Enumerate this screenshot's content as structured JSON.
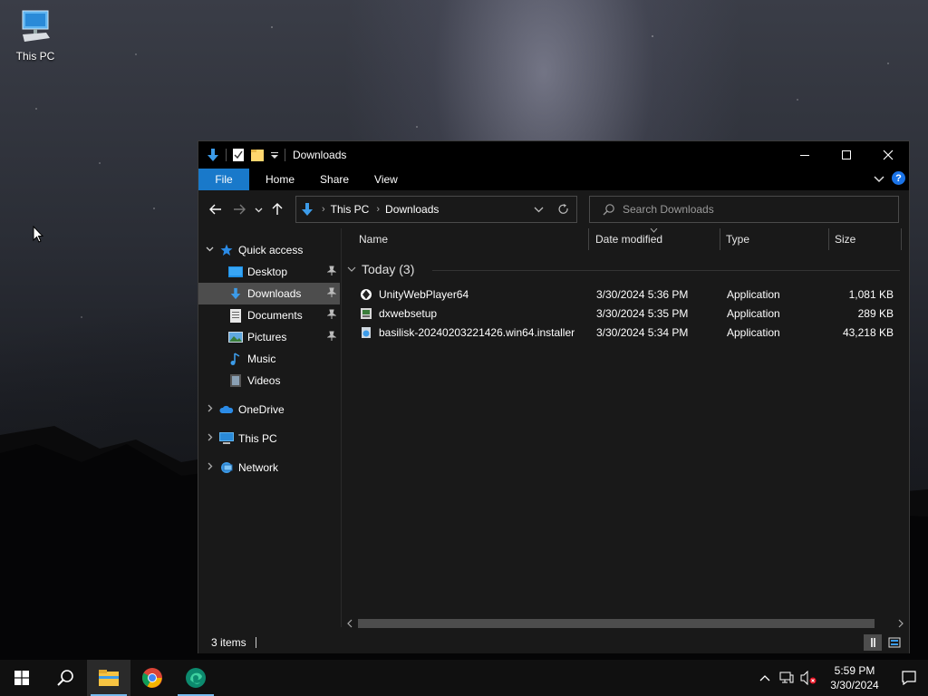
{
  "desktop": {
    "icons": [
      {
        "label": "This PC",
        "icon": "this-pc-icon"
      }
    ]
  },
  "window": {
    "title": "Downloads",
    "controls": {
      "minimize": "minimize-icon",
      "maximize": "maximize-icon",
      "close": "close-icon"
    }
  },
  "ribbon": {
    "tabs": [
      "File",
      "Home",
      "Share",
      "View"
    ],
    "help_label": "?"
  },
  "address": {
    "segments": [
      "This PC",
      "Downloads"
    ]
  },
  "search": {
    "placeholder": "Search Downloads"
  },
  "nav_pane": {
    "quick_access": "Quick access",
    "pinned": [
      {
        "label": "Desktop",
        "icon": "desktop-folder-icon",
        "pinned": true
      },
      {
        "label": "Downloads",
        "icon": "downloads-folder-icon",
        "pinned": true,
        "selected": true
      },
      {
        "label": "Documents",
        "icon": "documents-folder-icon",
        "pinned": true
      },
      {
        "label": "Pictures",
        "icon": "pictures-folder-icon",
        "pinned": true
      },
      {
        "label": "Music",
        "icon": "music-folder-icon",
        "pinned": false
      },
      {
        "label": "Videos",
        "icon": "videos-folder-icon",
        "pinned": false
      }
    ],
    "roots": [
      {
        "label": "OneDrive",
        "icon": "onedrive-icon"
      },
      {
        "label": "This PC",
        "icon": "this-pc-icon"
      },
      {
        "label": "Network",
        "icon": "network-icon"
      }
    ]
  },
  "file_list": {
    "columns": [
      "Name",
      "Date modified",
      "Type",
      "Size"
    ],
    "group_label": "Today (3)",
    "rows": [
      {
        "name": "UnityWebPlayer64",
        "date": "3/30/2024 5:36 PM",
        "type": "Application",
        "size": "1,081 KB"
      },
      {
        "name": "dxwebsetup",
        "date": "3/30/2024 5:35 PM",
        "type": "Application",
        "size": "289 KB"
      },
      {
        "name": "basilisk-20240203221426.win64.installer",
        "date": "3/30/2024 5:34 PM",
        "type": "Application",
        "size": "43,218 KB"
      }
    ]
  },
  "status_bar": {
    "item_count": "3 items"
  },
  "taskbar": {
    "apps": [
      "start-icon",
      "search-icon",
      "file-explorer-icon",
      "chrome-icon",
      "edge-icon"
    ],
    "clock_time": "5:59 PM",
    "clock_date": "3/30/2024"
  }
}
